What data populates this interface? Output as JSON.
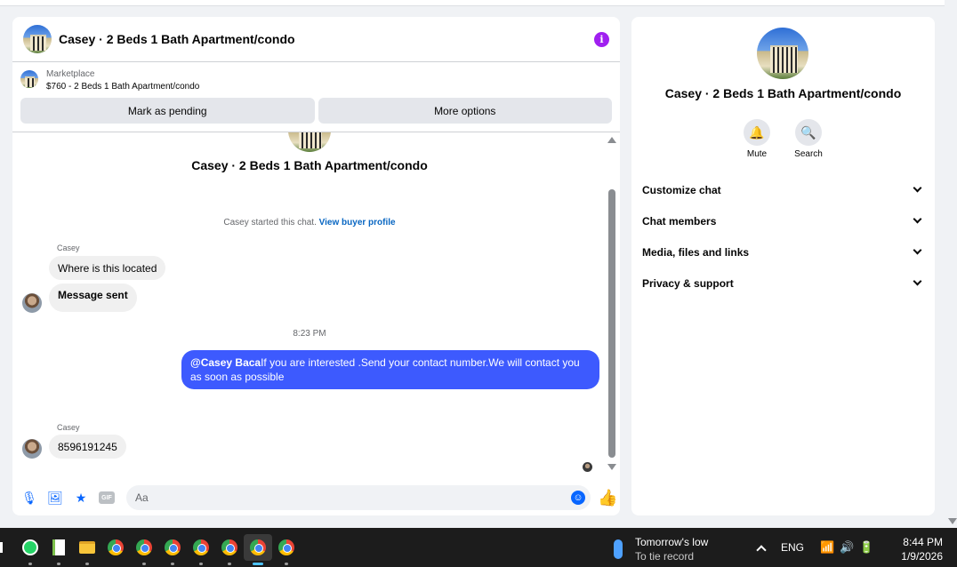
{
  "chat": {
    "title": "Casey · 2 Beds 1 Bath Apartment/condo",
    "marketplace_label": "Marketplace",
    "listing": "$760 - 2 Beds 1 Bath Apartment/condo",
    "mark_pending": "Mark as pending",
    "more_options": "More options",
    "hero_title": "Casey · 2 Beds 1 Bath Apartment/condo",
    "started_text": "Casey started this chat.",
    "view_buyer_profile": "View buyer profile",
    "messages": [
      {
        "sender": "Casey",
        "text": "Where is this located"
      },
      {
        "text": "Message sent"
      },
      {
        "time": "8:23 PM"
      },
      {
        "mention": "@Casey Baca",
        "text": "If you are interested .Send your contact number.We will contact you as soon as possible"
      },
      {
        "sender": "Casey",
        "text": "8596191245"
      }
    ],
    "composer_placeholder": "Aa",
    "gif_label": "GIF",
    "accent": "#3d5afe"
  },
  "sidebar": {
    "title": "Casey · 2 Beds 1 Bath Apartment/condo",
    "mute_label": "Mute",
    "search_label": "Search",
    "menu": [
      "Customize chat",
      "Chat members",
      "Media, files and links",
      "Privacy & support"
    ]
  },
  "taskbar": {
    "weather_title": "Tomorrow's low",
    "weather_sub": "To tie record",
    "lang": "ENG",
    "time": "8:44 PM",
    "date": "1/9/2026"
  }
}
